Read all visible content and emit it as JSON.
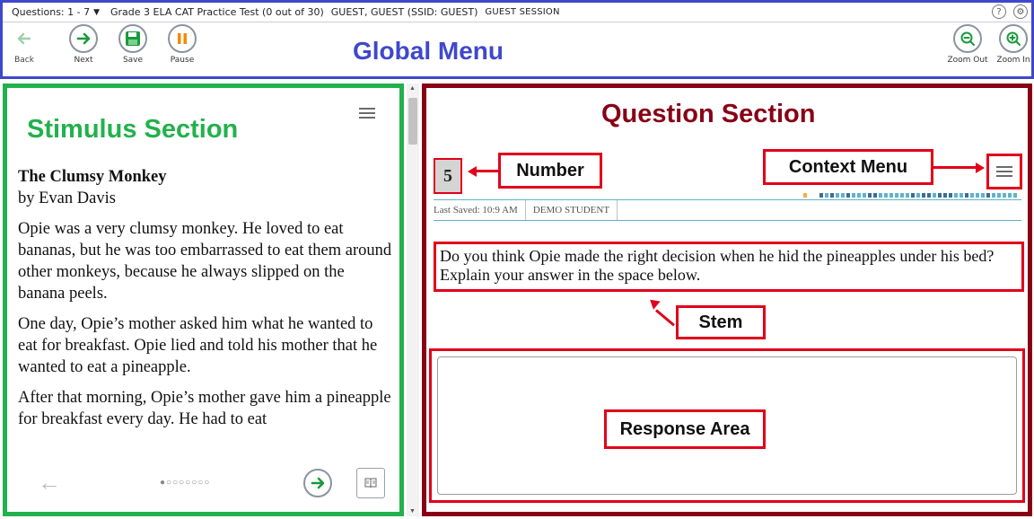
{
  "infobar": {
    "question_selector": "Questions:  1 - 7",
    "test_name": "Grade 3 ELA CAT Practice Test (0 out of 30)",
    "user": "GUEST, GUEST (SSID: GUEST)",
    "session": "GUEST SESSION",
    "help_icon": "?",
    "settings_icon": "gear-icon"
  },
  "toolbar": {
    "back_label": "Back",
    "next_label": "Next",
    "save_label": "Save",
    "pause_label": "Pause",
    "zoom_out_label": "Zoom Out",
    "zoom_in_label": "Zoom In",
    "global_title": "Global Menu",
    "accent_blue": "#3f48cc"
  },
  "stimulus": {
    "section_title": "Stimulus Section",
    "passage_title": "The Clumsy Monkey",
    "byline": "by Evan Davis",
    "paragraphs": [
      "Opie was a very clumsy monkey. He loved to eat bananas, but he was too embarrassed to eat them around other monkeys, because he always slipped on the banana peels.",
      "One day, Opie’s mother asked him what  he wanted to eat for breakfast. Opie lied and told his mother that he wanted to eat a pineapple.",
      "After that morning, Opie’s mother gave him a pineapple for breakfast every day. He had to eat"
    ],
    "page_dots": "●○○○○○○○",
    "border_color": "#22b14c"
  },
  "question": {
    "section_title": "Question Section",
    "number": "5",
    "number_callout": "Number",
    "context_menu_callout": "Context Menu",
    "last_saved": "Last Saved: 10:9 AM",
    "student": "DEMO STUDENT",
    "stem": "Do you think Opie made the right decision when he hid the pineapples under his bed? Explain your answer in the space below.",
    "stem_callout": "Stem",
    "response_callout": "Response Area",
    "border_color": "#880015",
    "callout_color": "#e2001a"
  }
}
